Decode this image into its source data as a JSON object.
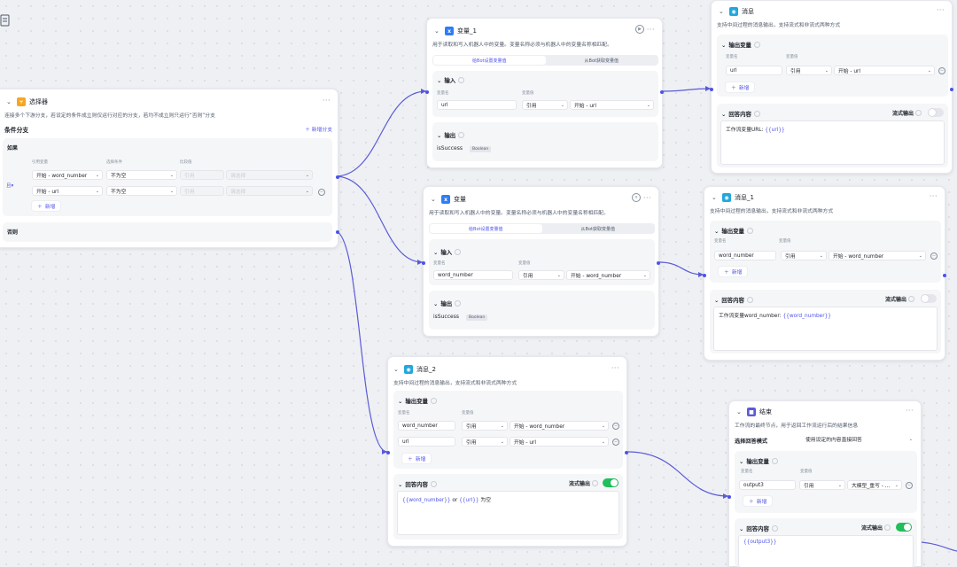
{
  "canvas": {
    "note_icon": "document-icon",
    "edge_color": "#5b5bd6",
    "accent": "#4d53e8",
    "toggle_on": "#1fbf5c"
  },
  "selector_node": {
    "title": "选择器",
    "icon": "branch-icon",
    "description": "连接多个下游分支，若设定的条件成立则仅运行对应的分支，若均不成立则只运行“否则”分支",
    "section_title": "条件分支",
    "add_branch": "新增分支",
    "if_label": "如果",
    "col_ref": "引用变量",
    "col_cond": "选择条件",
    "col_cmp": "比较值",
    "and_label": "且",
    "rows": [
      {
        "ref": "开始 - word_number",
        "cond": "不为空",
        "cmp_type": "引用",
        "cmp_value": "请选择"
      },
      {
        "ref": "开始 - url",
        "cond": "不为空",
        "cmp_type": "引用",
        "cmp_value": "请选择"
      }
    ],
    "add_label": "新增",
    "else_label": "否则"
  },
  "var1_node": {
    "title": "变量_1",
    "icon": "variable-icon",
    "description": "用于读取和写入机器人中的变量。变量名称必须与机器人中的变量名称相匹配。",
    "tabs": [
      "给Bot设置变量值",
      "从Bot获取变量值"
    ],
    "input_title": "输入",
    "col_name": "变量名",
    "col_value": "变量值",
    "row": {
      "name": "url",
      "type": "引用",
      "value": "开始 - url"
    },
    "output_title": "输出",
    "out_name": "isSuccess",
    "out_type": "Boolean"
  },
  "var_node": {
    "title": "变量",
    "icon": "variable-icon",
    "description": "用于读取和写入机器人中的变量。变量名称必须与机器人中的变量名称相匹配。",
    "tabs": [
      "给Bot设置变量值",
      "从Bot获取变量值"
    ],
    "input_title": "输入",
    "col_name": "变量名",
    "col_value": "变量值",
    "row": {
      "name": "word_number",
      "type": "引用",
      "value": "开始 - word_number"
    },
    "output_title": "输出",
    "out_name": "isSuccess",
    "out_type": "Boolean"
  },
  "msg_node": {
    "title": "消息",
    "icon": "message-icon",
    "description": "支持中间过程的消息输出，支持流式和非流式两种方式",
    "output_title": "输出变量",
    "col_name": "变量名",
    "col_value": "变量值",
    "row": {
      "name": "url",
      "type": "引用",
      "value": "开始 - url"
    },
    "add_label": "新增",
    "reply_title": "回答内容",
    "stream_label": "流式输出",
    "stream_on": false,
    "content": "工作流变量URL: ",
    "content_var": "{{url}}"
  },
  "msg1_node": {
    "title": "消息_1",
    "icon": "message-icon",
    "description": "支持中间过程的消息输出，支持流式和非流式两种方式",
    "output_title": "输出变量",
    "col_name": "变量名",
    "col_value": "变量值",
    "row": {
      "name": "word_number",
      "type": "引用",
      "value": "开始 - word_number"
    },
    "add_label": "新增",
    "reply_title": "回答内容",
    "stream_label": "流式输出",
    "stream_on": false,
    "content": "工作流变量word_number: ",
    "content_var": "{{word_number}}"
  },
  "msg2_node": {
    "title": "消息_2",
    "icon": "message-icon",
    "description": "支持中间过程的消息输出，支持流式和非流式两种方式",
    "output_title": "输出变量",
    "col_name": "变量名",
    "col_value": "变量值",
    "rows": [
      {
        "name": "word_number",
        "type": "引用",
        "value": "开始 - word_number"
      },
      {
        "name": "url",
        "type": "引用",
        "value": "开始 - url"
      }
    ],
    "add_label": "新增",
    "reply_title": "回答内容",
    "stream_label": "流式输出",
    "stream_on": true,
    "content_a": "{{word_number}}",
    "content_b": " or ",
    "content_c": "{{url}}",
    "content_d": " 为空"
  },
  "end_node": {
    "title": "结束",
    "icon": "end-icon",
    "description": "工作流的最终节点，用于返回工作流运行后的结果信息",
    "mode_label": "选择回答模式",
    "mode_value": "使用设定的内容直接回答",
    "output_title": "输出变量",
    "col_name": "变量名",
    "col_value": "变量值",
    "row": {
      "name": "output3",
      "type": "引用",
      "value": "大模型_重写 - ..."
    },
    "add_label": "新增",
    "reply_title": "回答内容",
    "stream_label": "流式输出",
    "stream_on": true,
    "content": "{{output3}}"
  }
}
